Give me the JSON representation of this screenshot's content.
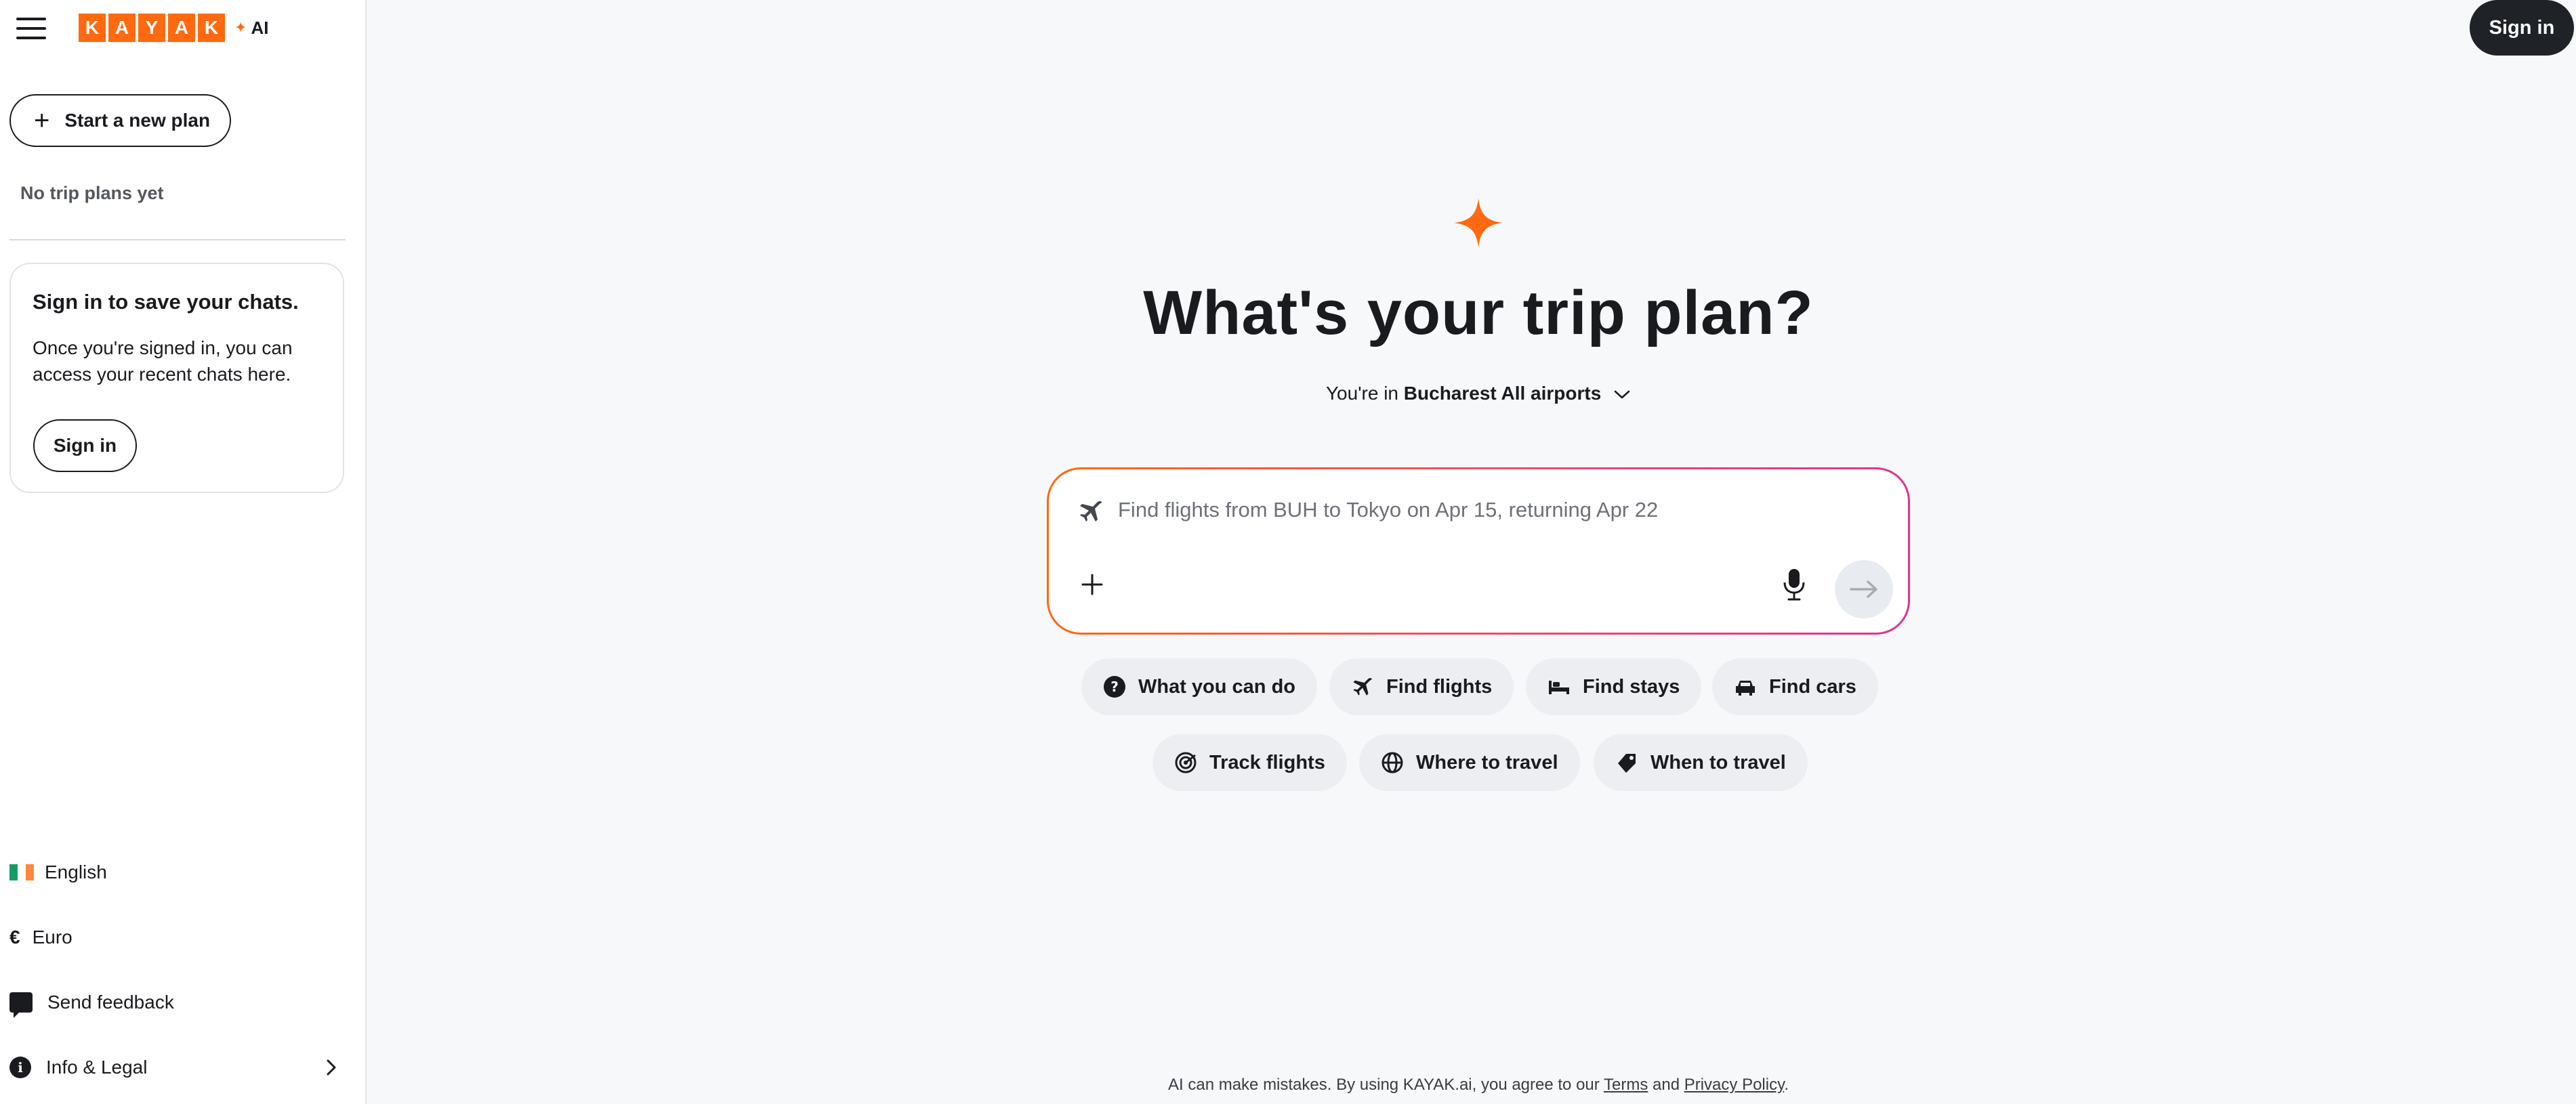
{
  "brand": {
    "logo_letters": [
      "K",
      "A",
      "Y",
      "A",
      "K"
    ],
    "logo_suffix": "AI",
    "accent_color": "#ff690f"
  },
  "sidebar": {
    "menu_icon": "hamburger-icon",
    "new_plan_label": "Start a new plan",
    "empty_state": "No trip plans yet",
    "signin_card": {
      "title": "Sign in to save your chats.",
      "body": "Once you're signed in, you can access your recent chats here.",
      "button_label": "Sign in"
    },
    "footer": {
      "language": "English",
      "currency_symbol": "€",
      "currency": "Euro",
      "feedback": "Send feedback",
      "info": "Info & Legal"
    }
  },
  "header": {
    "signin_label": "Sign in"
  },
  "main": {
    "heading": "What's your trip plan?",
    "location_prefix": "You're in",
    "location_value": "Bucharest All airports",
    "prompt_placeholder": "Find flights from BUH to Tokyo on Apr 15, returning Apr 22",
    "chips_row1": [
      "What you can do",
      "Find flights",
      "Find stays",
      "Find cars"
    ],
    "chips_row2": [
      "Track flights",
      "Where to travel",
      "When to travel"
    ],
    "disclaimer_prefix": "AI can make mistakes. By using KAYAK.ai, you agree to our",
    "disclaimer_terms": "Terms",
    "disclaimer_and": "and",
    "disclaimer_privacy": "Privacy Policy",
    "disclaimer_end": "."
  }
}
